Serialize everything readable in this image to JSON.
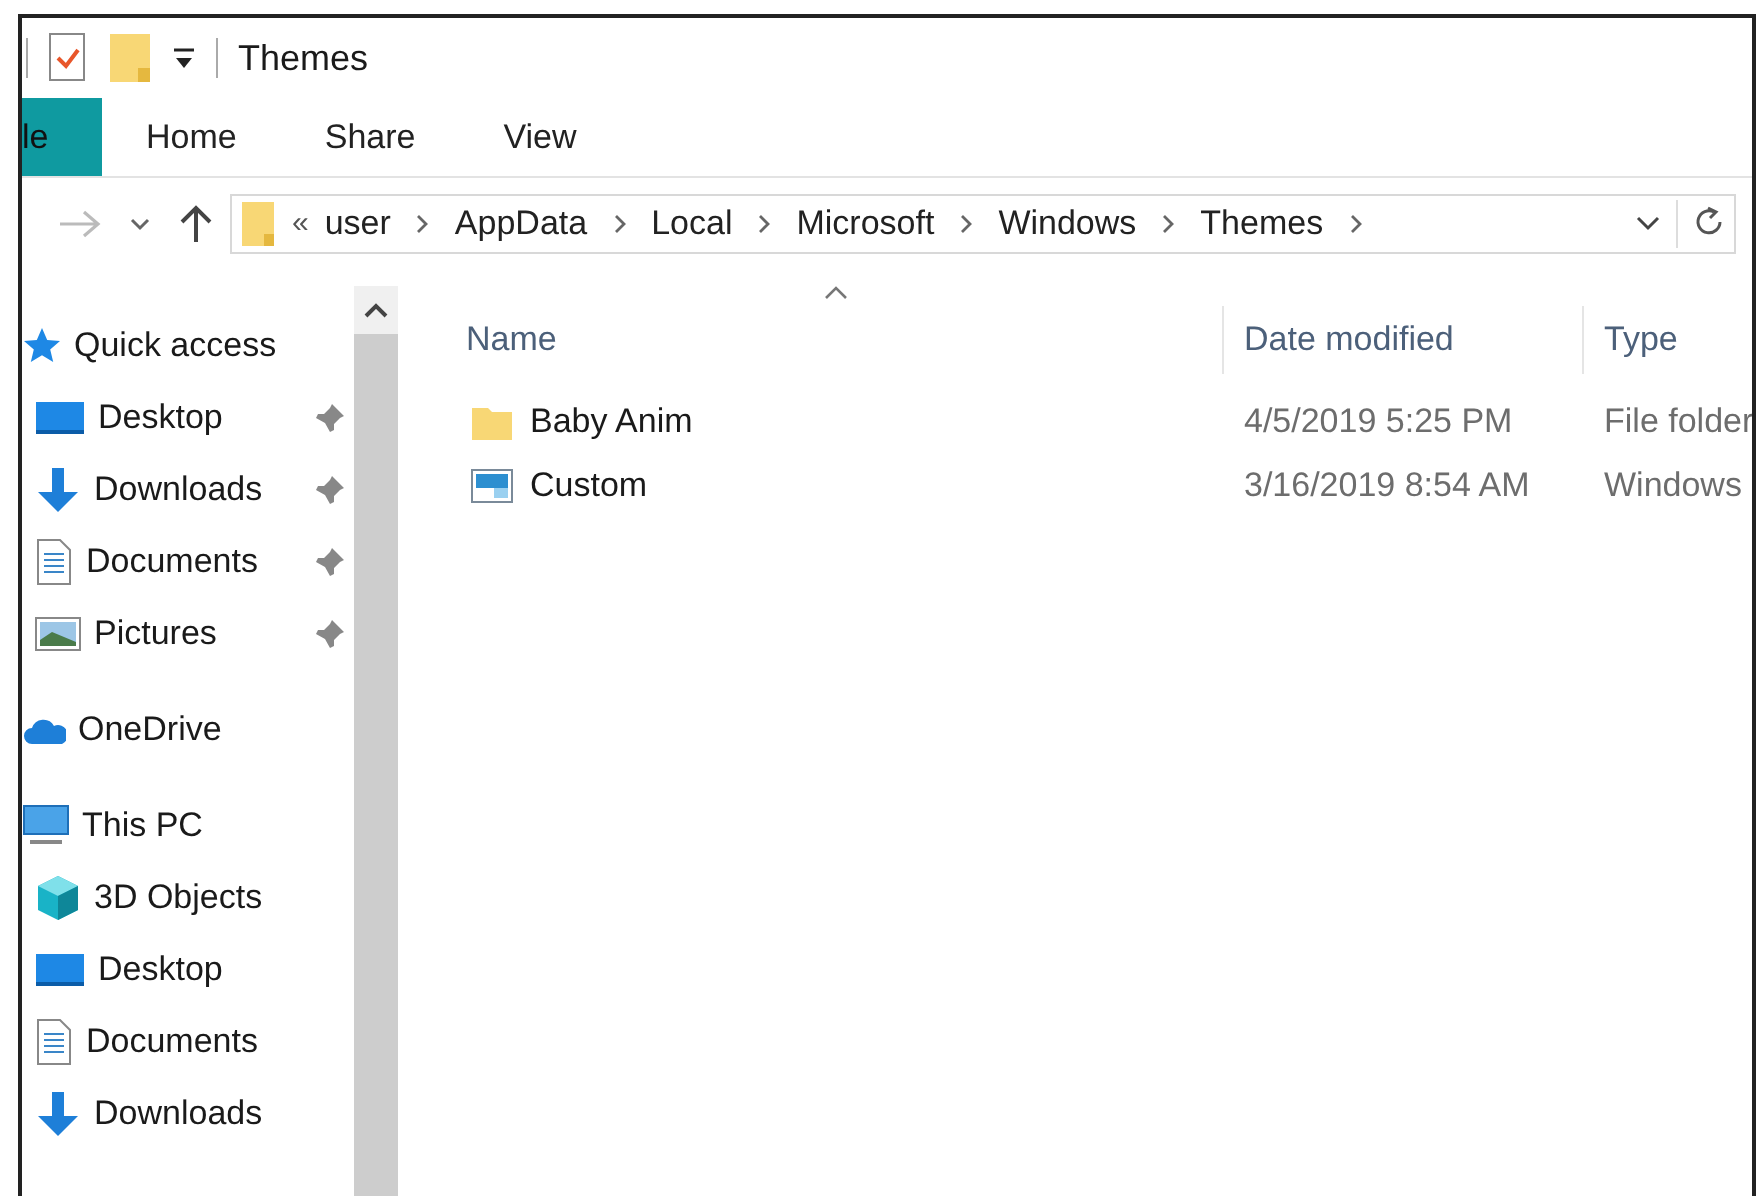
{
  "window": {
    "title": "Themes"
  },
  "ribbon_tabs": [
    {
      "label": "le",
      "kind": "file"
    },
    {
      "label": "Home",
      "kind": "tab"
    },
    {
      "label": "Share",
      "kind": "tab"
    },
    {
      "label": "View",
      "kind": "tab"
    }
  ],
  "address_bar": {
    "overflow": "«",
    "crumbs": [
      "user",
      "AppData",
      "Local",
      "Microsoft",
      "Windows",
      "Themes"
    ]
  },
  "sidebar": {
    "items": [
      {
        "label": "Quick access",
        "kind": "star",
        "children": [
          {
            "label": "Desktop",
            "kind": "desktop",
            "pinned": true
          },
          {
            "label": "Downloads",
            "kind": "download",
            "pinned": true
          },
          {
            "label": "Documents",
            "kind": "document",
            "pinned": true
          },
          {
            "label": "Pictures",
            "kind": "picture",
            "pinned": true
          }
        ]
      },
      {
        "label": "OneDrive",
        "kind": "cloud"
      },
      {
        "label": "This PC",
        "kind": "pc",
        "children": [
          {
            "label": "3D Objects",
            "kind": "cube",
            "pinned": false
          },
          {
            "label": "Desktop",
            "kind": "desktop",
            "pinned": false
          },
          {
            "label": "Documents",
            "kind": "document",
            "pinned": false
          },
          {
            "label": "Downloads",
            "kind": "download",
            "pinned": false
          }
        ]
      }
    ]
  },
  "table": {
    "columns": [
      "Name",
      "Date modified",
      "Type"
    ],
    "rows": [
      {
        "kind": "folder",
        "name": "Baby Anim",
        "date": "4/5/2019 5:25 PM",
        "type": "File folder"
      },
      {
        "kind": "theme",
        "name": "Custom",
        "date": "3/16/2019 8:54 AM",
        "type": "Windows"
      }
    ]
  }
}
